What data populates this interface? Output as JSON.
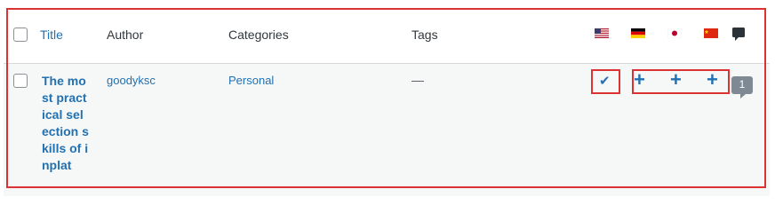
{
  "header": {
    "title_label": "Title",
    "author_label": "Author",
    "categories_label": "Categories",
    "tags_label": "Tags",
    "languages": [
      {
        "code": "en-us",
        "flag": "us-flag-icon"
      },
      {
        "code": "de",
        "flag": "germany-flag-icon"
      },
      {
        "code": "ja",
        "flag": "japan-flag-icon"
      },
      {
        "code": "zh",
        "flag": "china-flag-icon"
      }
    ],
    "comments_icon": "comment-icon"
  },
  "row": {
    "title": "The most practical selection skills of inplat",
    "author": "goodyksc",
    "category": "Personal",
    "tags": "—",
    "translation_status": [
      "check",
      "plus",
      "plus",
      "plus"
    ],
    "comment_count": "1"
  },
  "colors": {
    "link": "#2271b1",
    "highlight": "#dc3232",
    "row_bg": "#f6f7f7"
  }
}
